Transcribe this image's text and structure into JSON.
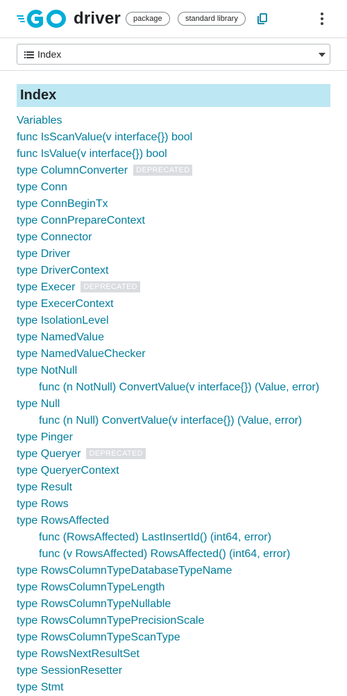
{
  "header": {
    "title": "driver",
    "chips": [
      "package",
      "standard library"
    ]
  },
  "nav": {
    "selected": "Index"
  },
  "index": {
    "heading": "Index",
    "badge_label": "DEPRECATED",
    "items": [
      {
        "text": "Variables",
        "indent": false,
        "deprecated": false
      },
      {
        "text": "func IsScanValue(v interface{}) bool",
        "indent": false,
        "deprecated": false
      },
      {
        "text": "func IsValue(v interface{}) bool",
        "indent": false,
        "deprecated": false
      },
      {
        "text": "type ColumnConverter",
        "indent": false,
        "deprecated": true
      },
      {
        "text": "type Conn",
        "indent": false,
        "deprecated": false
      },
      {
        "text": "type ConnBeginTx",
        "indent": false,
        "deprecated": false
      },
      {
        "text": "type ConnPrepareContext",
        "indent": false,
        "deprecated": false
      },
      {
        "text": "type Connector",
        "indent": false,
        "deprecated": false
      },
      {
        "text": "type Driver",
        "indent": false,
        "deprecated": false
      },
      {
        "text": "type DriverContext",
        "indent": false,
        "deprecated": false
      },
      {
        "text": "type Execer",
        "indent": false,
        "deprecated": true
      },
      {
        "text": "type ExecerContext",
        "indent": false,
        "deprecated": false
      },
      {
        "text": "type IsolationLevel",
        "indent": false,
        "deprecated": false
      },
      {
        "text": "type NamedValue",
        "indent": false,
        "deprecated": false
      },
      {
        "text": "type NamedValueChecker",
        "indent": false,
        "deprecated": false
      },
      {
        "text": "type NotNull",
        "indent": false,
        "deprecated": false
      },
      {
        "text": "func (n NotNull) ConvertValue(v interface{}) (Value, error)",
        "indent": true,
        "deprecated": false
      },
      {
        "text": "type Null",
        "indent": false,
        "deprecated": false
      },
      {
        "text": "func (n Null) ConvertValue(v interface{}) (Value, error)",
        "indent": true,
        "deprecated": false
      },
      {
        "text": "type Pinger",
        "indent": false,
        "deprecated": false
      },
      {
        "text": "type Queryer",
        "indent": false,
        "deprecated": true
      },
      {
        "text": "type QueryerContext",
        "indent": false,
        "deprecated": false
      },
      {
        "text": "type Result",
        "indent": false,
        "deprecated": false
      },
      {
        "text": "type Rows",
        "indent": false,
        "deprecated": false
      },
      {
        "text": "type RowsAffected",
        "indent": false,
        "deprecated": false
      },
      {
        "text": "func (RowsAffected) LastInsertId() (int64, error)",
        "indent": true,
        "deprecated": false
      },
      {
        "text": "func (v RowsAffected) RowsAffected() (int64, error)",
        "indent": true,
        "deprecated": false
      },
      {
        "text": "type RowsColumnTypeDatabaseTypeName",
        "indent": false,
        "deprecated": false
      },
      {
        "text": "type RowsColumnTypeLength",
        "indent": false,
        "deprecated": false
      },
      {
        "text": "type RowsColumnTypeNullable",
        "indent": false,
        "deprecated": false
      },
      {
        "text": "type RowsColumnTypePrecisionScale",
        "indent": false,
        "deprecated": false
      },
      {
        "text": "type RowsColumnTypeScanType",
        "indent": false,
        "deprecated": false
      },
      {
        "text": "type RowsNextResultSet",
        "indent": false,
        "deprecated": false
      },
      {
        "text": "type SessionResetter",
        "indent": false,
        "deprecated": false
      },
      {
        "text": "type Stmt",
        "indent": false,
        "deprecated": false
      }
    ]
  },
  "icons": {
    "logo": "go-logo-icon",
    "copy": "copy-icon",
    "more": "more-vert-icon",
    "list": "list-icon",
    "caret": "caret-down-icon"
  },
  "colors": {
    "link": "#007d9c",
    "brand": "#00add8",
    "heading_bg": "#bde7f2",
    "badge_bg": "#dadce0"
  }
}
